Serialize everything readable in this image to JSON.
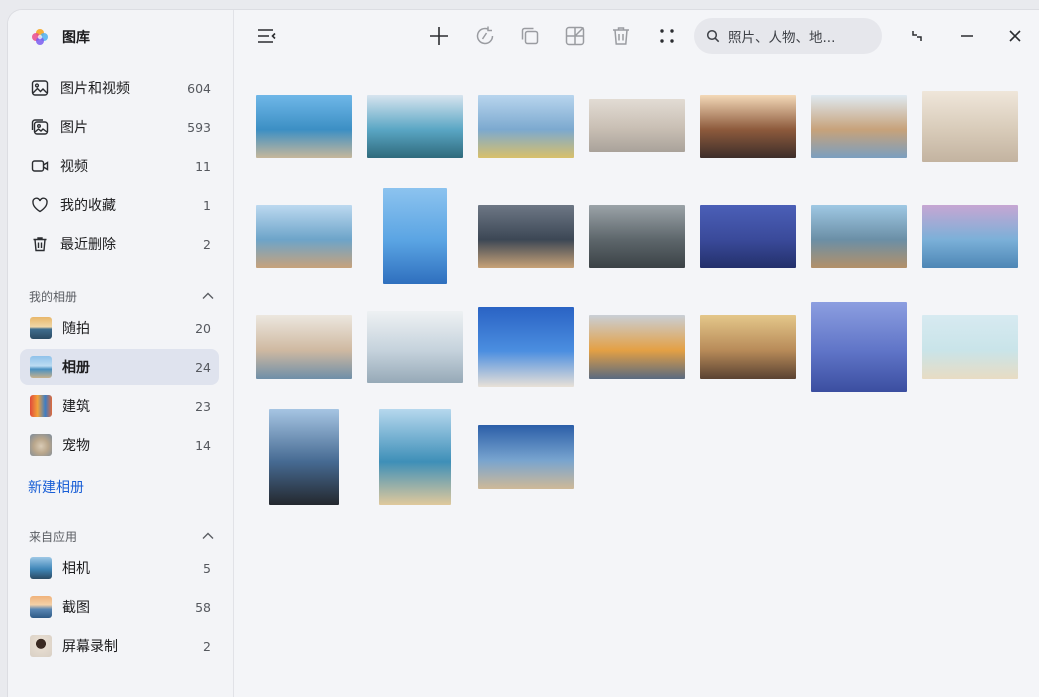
{
  "app": {
    "title": "图库"
  },
  "library": [
    {
      "label": "图片和视频",
      "count": "604",
      "icon": "image-icon"
    },
    {
      "label": "图片",
      "count": "593",
      "icon": "photos-icon"
    },
    {
      "label": "视频",
      "count": "11",
      "icon": "video-icon"
    },
    {
      "label": "我的收藏",
      "count": "1",
      "icon": "heart-icon"
    },
    {
      "label": "最近删除",
      "count": "2",
      "icon": "trash-icon"
    }
  ],
  "my_albums": {
    "header": "我的相册",
    "items": [
      {
        "label": "随拍",
        "count": "20"
      },
      {
        "label": "相册",
        "count": "24",
        "active": true
      },
      {
        "label": "建筑",
        "count": "23"
      },
      {
        "label": "宠物",
        "count": "14"
      }
    ],
    "new_album": "新建相册"
  },
  "from_apps": {
    "header": "来自应用",
    "items": [
      {
        "label": "相机",
        "count": "5"
      },
      {
        "label": "截图",
        "count": "58"
      },
      {
        "label": "屏幕录制",
        "count": "2"
      }
    ]
  },
  "toolbar": {
    "icons": [
      "sidebar-toggle-icon",
      "add-icon",
      "rotate-icon",
      "copy-icon",
      "collage-icon",
      "delete-icon",
      "more-icon"
    ],
    "search_placeholder": "照片、人物、地...",
    "window_icons": [
      "restore-icon",
      "minimize-icon",
      "close-icon"
    ]
  },
  "photos": [
    {
      "name": "woman-on-pier-photo",
      "colors": [
        "#6fb7e8",
        "#3c8fc4",
        "#c6b79b"
      ]
    },
    {
      "name": "mountain-lake-photo",
      "colors": [
        "#d7e4ef",
        "#5aa6c4",
        "#2f6a7c"
      ]
    },
    {
      "name": "reflection-jump-photo",
      "colors": [
        "#b8d5ee",
        "#7ca9cf",
        "#d9c06a"
      ]
    },
    {
      "name": "arch-architecture-photo",
      "colors": [
        "#e2dcd4",
        "#c9bfb4",
        "#a9a29a"
      ]
    },
    {
      "name": "bullet-train-photo",
      "colors": [
        "#f3d9b8",
        "#8d5a3c",
        "#3d2e2a"
      ]
    },
    {
      "name": "woman-with-hat-photo",
      "colors": [
        "#dfe9f1",
        "#c7a27a",
        "#7b9fc0"
      ]
    },
    {
      "name": "wall-shelves-photo",
      "colors": [
        "#efe6da",
        "#d8cbb9",
        "#c3b3a0"
      ]
    },
    {
      "name": "city-beach-seagulls-photo",
      "colors": [
        "#bcd9f0",
        "#6da4c9",
        "#c7a27b"
      ]
    },
    {
      "name": "boy-jumping-blue-photo",
      "colors": [
        "#8cc3ef",
        "#5aa4e3",
        "#2f6fbe"
      ]
    },
    {
      "name": "surfer-sunset-photo",
      "colors": [
        "#6d7785",
        "#3c4755",
        "#c7a277"
      ]
    },
    {
      "name": "sunrays-clouds-photo",
      "colors": [
        "#9ba3a8",
        "#5d666b",
        "#3b4246"
      ]
    },
    {
      "name": "blueberries-photo",
      "colors": [
        "#4b5fb7",
        "#3a4a9a",
        "#23306b"
      ]
    },
    {
      "name": "daydream-sign-photo",
      "colors": [
        "#9fc8e4",
        "#6b8fa6",
        "#b39069"
      ]
    },
    {
      "name": "pier-sunset-photo",
      "colors": [
        "#c6a6d3",
        "#7bb0d8",
        "#4d86b5"
      ]
    },
    {
      "name": "mother-child-photo",
      "colors": [
        "#ece7df",
        "#cfb9a1",
        "#6f8fa8"
      ]
    },
    {
      "name": "dandelion-photo",
      "colors": [
        "#eef1f3",
        "#c5d2dc",
        "#96a9b7"
      ]
    },
    {
      "name": "man-jumping-photo",
      "colors": [
        "#2a63c4",
        "#4b8ee0",
        "#e8e1d8"
      ]
    },
    {
      "name": "woman-smiling-phone-photo",
      "colors": [
        "#c9cfd6",
        "#e4a044",
        "#5a6a80"
      ]
    },
    {
      "name": "woman-curly-hair-photo",
      "colors": [
        "#e4c78a",
        "#b88b59",
        "#5a4232"
      ]
    },
    {
      "name": "succulent-photo",
      "colors": [
        "#8c9ee0",
        "#5f74c7",
        "#3b4ea0"
      ]
    },
    {
      "name": "starfish-beach-photo",
      "colors": [
        "#d7eaf1",
        "#c9e4e9",
        "#e8dcc3"
      ]
    },
    {
      "name": "cliff-jump-silhouette-photo",
      "colors": [
        "#a6c5e3",
        "#466a92",
        "#24282e"
      ]
    },
    {
      "name": "lifeguard-tower-photo",
      "colors": [
        "#b6d8ee",
        "#3e8fb8",
        "#e0c99c"
      ]
    },
    {
      "name": "skateboarder-photo",
      "colors": [
        "#2b5ea8",
        "#78a4cf",
        "#cfb998"
      ]
    }
  ]
}
